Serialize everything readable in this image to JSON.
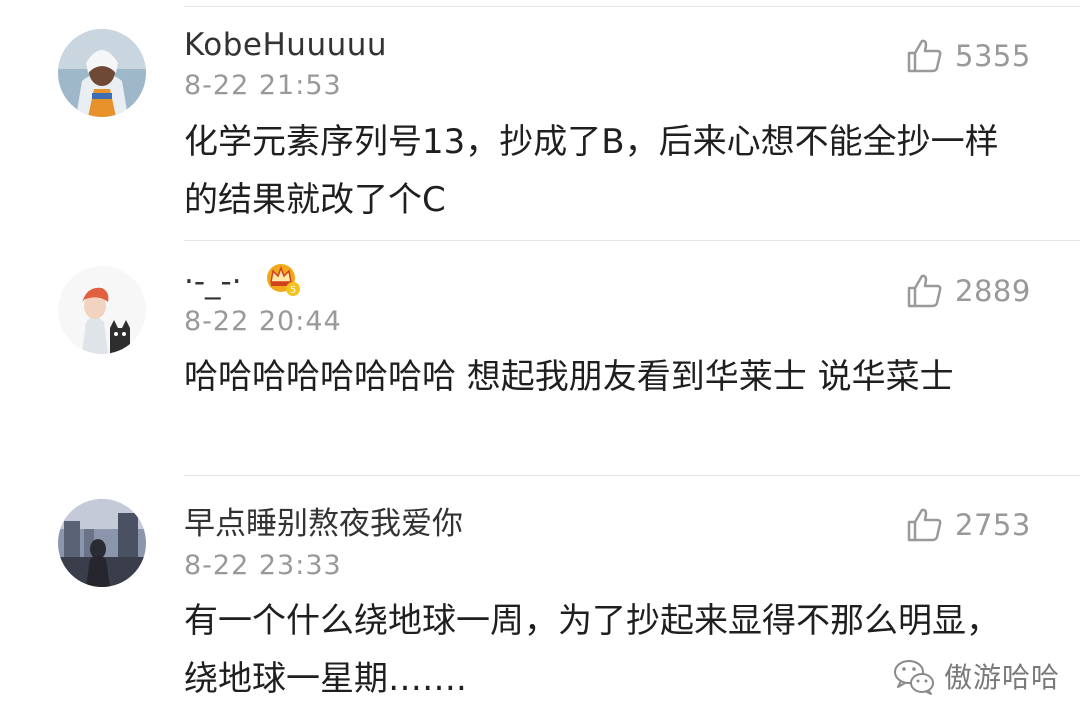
{
  "comments": [
    {
      "username": "KobeHuuuuu",
      "time": "8-22 21:53",
      "likes": "5355",
      "text": "化学元素序列号13，抄成了B，后来心想不能全抄一样的结果就改了个C"
    },
    {
      "username": "·-_-·",
      "time": "8-22 20:44",
      "likes": "2889",
      "text": "哈哈哈哈哈哈哈哈 想起我朋友看到华莱士 说华菜士"
    },
    {
      "username": "早点睡别熬夜我爱你",
      "time": "8-22 23:33",
      "likes": "2753",
      "text": "有一个什么绕地球一周，为了抄起来显得不那么明显，绕地球一星期……."
    }
  ],
  "badge": {
    "level": "5",
    "icon": "crown-vip-icon",
    "color": "#f2a81d"
  },
  "watermark": {
    "name": "傲游哈哈",
    "icon": "wechat-icon"
  },
  "colors": {
    "name": "#333333",
    "time": "#999999",
    "text": "#1f1f1f",
    "divider": "#e6e6e6"
  }
}
